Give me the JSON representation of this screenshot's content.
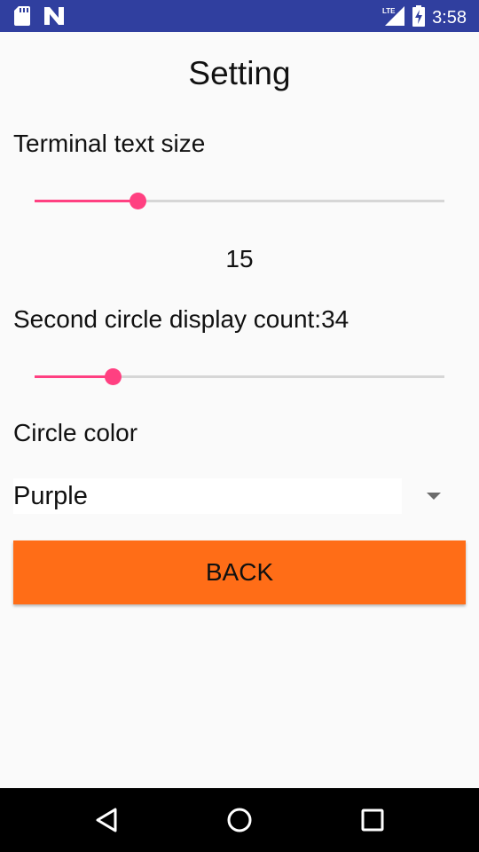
{
  "status_bar": {
    "time": "3:58",
    "network_label": "LTE",
    "icons": [
      "sd-card-icon",
      "n-logo-icon",
      "lte-signal-icon",
      "battery-charging-icon"
    ]
  },
  "page": {
    "title": "Setting"
  },
  "terminal_text_size": {
    "label": "Terminal text size",
    "slider_fraction": 0.25,
    "value_text": "15"
  },
  "second_circle": {
    "label": "Second circle display count:34",
    "slider_fraction": 0.19
  },
  "circle_color": {
    "label": "Circle color",
    "selected": "Purple"
  },
  "back_button": {
    "label": "BACK"
  },
  "nav_bar": {
    "icons": [
      "back-triangle-icon",
      "home-circle-icon",
      "recents-square-icon"
    ]
  },
  "colors": {
    "status_bar": "#303f9f",
    "accent": "#ff4081",
    "button": "#ff6d17",
    "background": "#fafafa"
  }
}
